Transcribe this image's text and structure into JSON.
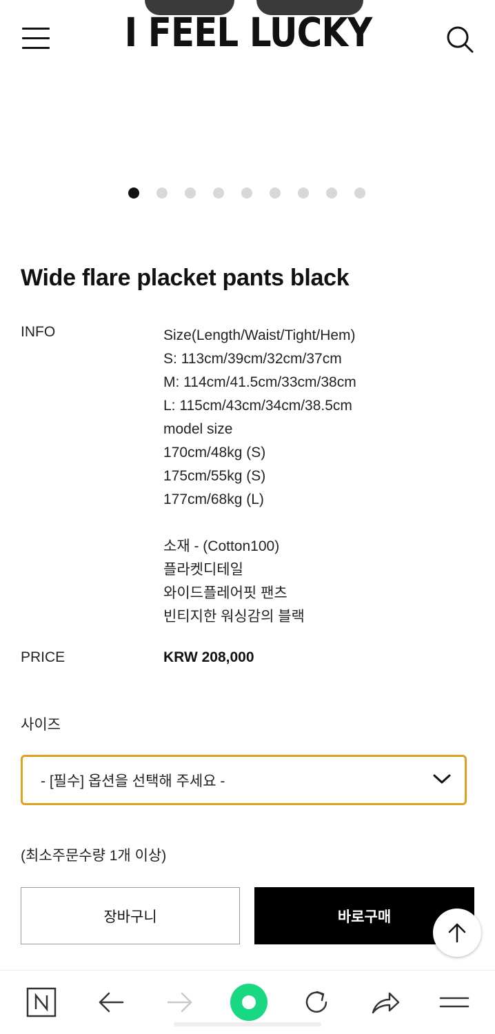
{
  "header": {
    "brand": "I FEEL LUCKY",
    "menu_icon": "hamburger-menu-icon",
    "search_icon": "search-icon"
  },
  "carousel": {
    "total_slides": 9,
    "active_index": 0
  },
  "product": {
    "title": "Wide flare placket pants black",
    "info_label": "INFO",
    "info_lines": [
      "Size(Length/Waist/Tight/Hem)",
      "S: 113cm/39cm/32cm/37cm",
      "M: 114cm/41.5cm/33cm/38cm",
      "L: 115cm/43cm/34cm/38.5cm",
      "model size",
      "170cm/48kg (S)",
      "175cm/55kg (S)",
      "177cm/68kg (L)",
      "",
      "소재 - (Cotton100)",
      "플라켓디테일",
      "와이드플레어핏 팬츠",
      "빈티지한 워싱감의 블랙"
    ],
    "price_label": "PRICE",
    "price": "KRW 208,000"
  },
  "options": {
    "size_label": "사이즈",
    "select_value": "- [필수] 옵션을 선택해 주세요 -",
    "min_order": "(최소주문수량 1개 이상)",
    "accent_color": "#e1a01f"
  },
  "actions": {
    "cart_label": "장바구니",
    "buy_label": "바로구매"
  },
  "browser_toolbar": {
    "items": [
      "naver-n-icon",
      "back-arrow-icon",
      "forward-arrow-icon",
      "green-dot-icon",
      "refresh-icon",
      "share-icon",
      "menu-lines-icon"
    ],
    "green_color": "#19d882"
  }
}
